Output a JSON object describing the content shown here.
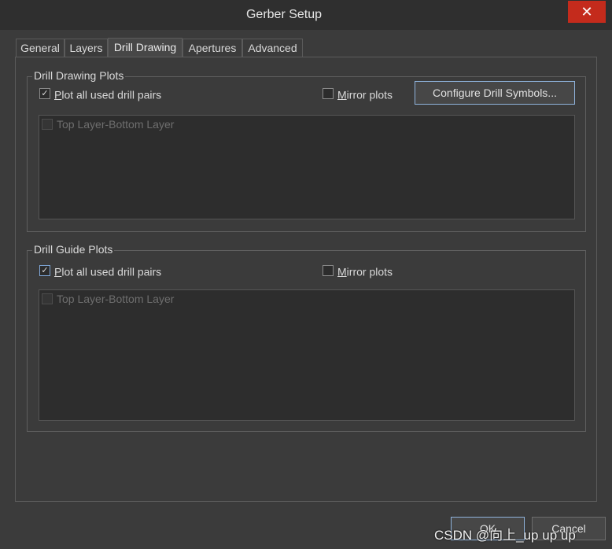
{
  "window": {
    "title": "Gerber Setup",
    "close_glyph": "✕"
  },
  "tabs": [
    {
      "label": "General"
    },
    {
      "label": "Layers"
    },
    {
      "label": "Drill Drawing"
    },
    {
      "label": "Apertures"
    },
    {
      "label": "Advanced"
    }
  ],
  "active_tab": "Drill Drawing",
  "drill_drawing_plots": {
    "title": "Drill Drawing Plots",
    "plot_all_first": "P",
    "plot_all_rest": "lot all used drill pairs",
    "plot_all_checked": true,
    "mirror_first": "M",
    "mirror_rest": "irror plots",
    "mirror_checked": false,
    "configure_button": "Configure Drill Symbols...",
    "layer_pairs": [
      "Top Layer-Bottom Layer"
    ]
  },
  "drill_guide_plots": {
    "title": "Drill Guide Plots",
    "plot_all_first": "P",
    "plot_all_rest": "lot all used drill pairs",
    "plot_all_checked": true,
    "mirror_first": "M",
    "mirror_rest": "irror plots",
    "mirror_checked": false,
    "layer_pairs": [
      "Top Layer-Bottom Layer"
    ]
  },
  "footer": {
    "ok_label": "OK",
    "cancel_label": "Cancel"
  },
  "watermark": "CSDN @向上_up up up",
  "check_glyph": "✓",
  "colors": {
    "close_button": "#c42b1c",
    "background": "#3b3b3b",
    "focus_border": "#8fb3dc"
  }
}
